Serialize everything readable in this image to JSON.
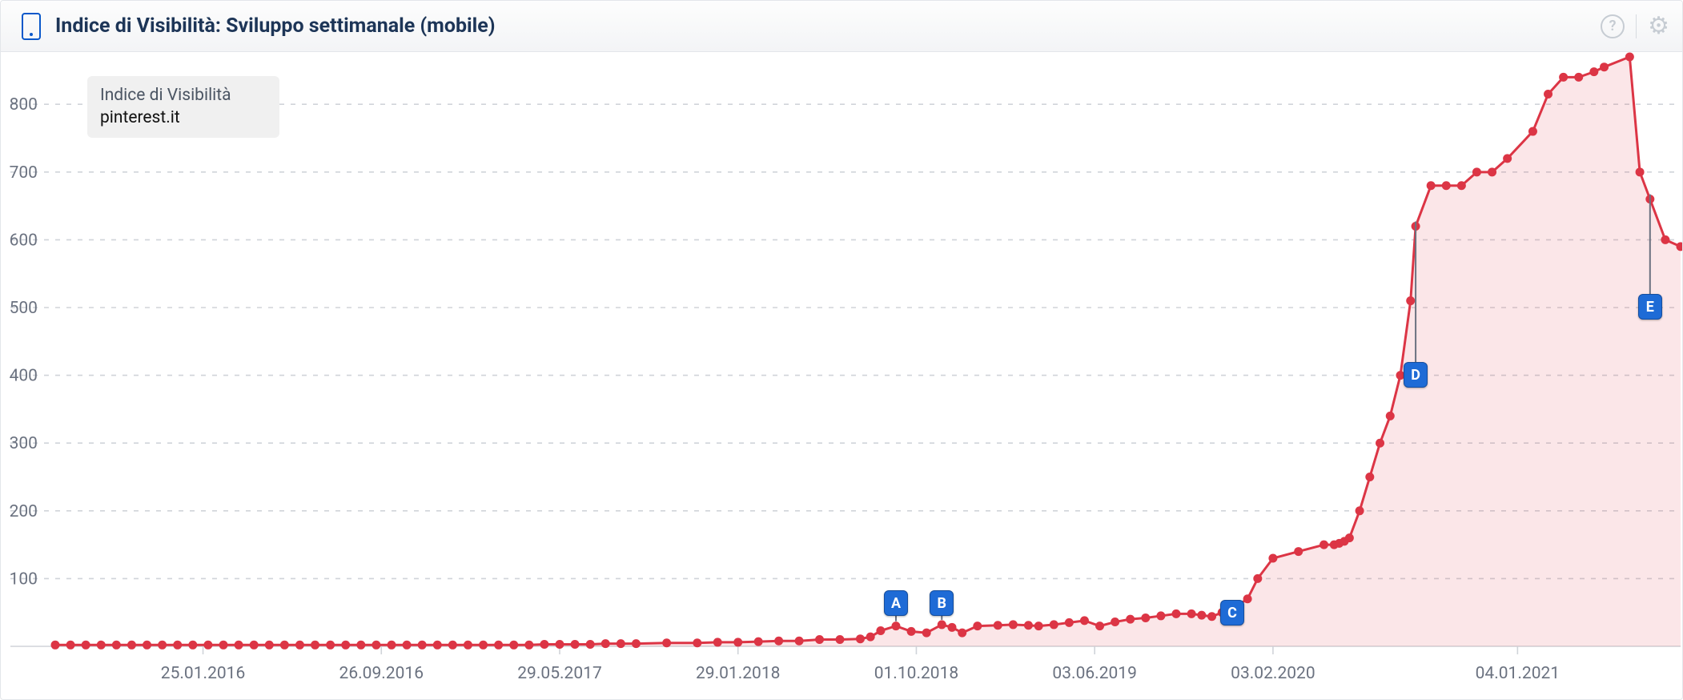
{
  "header": {
    "title": "Indice di Visibilità: Sviluppo settimanale (mobile)"
  },
  "legend": {
    "line1": "Indice di Visibilità",
    "line2": "pinterest.it"
  },
  "chart_data": {
    "type": "area",
    "title": "Indice di Visibilità: Sviluppo settimanale (mobile)",
    "xlabel": "",
    "ylabel": "",
    "ylim": [
      0,
      870
    ],
    "xlim": [
      0,
      319
    ],
    "y_ticks": [
      100,
      200,
      300,
      400,
      500,
      600,
      700,
      800
    ],
    "x_tick_labels": [
      "25.01.2016",
      "26.09.2016",
      "29.05.2017",
      "29.01.2018",
      "01.10.2018",
      "03.06.2019",
      "03.02.2020",
      "04.01.2021"
    ],
    "x_tick_positions": [
      29,
      64,
      99,
      134,
      169,
      204,
      239,
      287
    ],
    "series": [
      {
        "name": "pinterest.it",
        "color": "#dc3545",
        "x": [
          0,
          3,
          6,
          9,
          12,
          15,
          18,
          21,
          24,
          27,
          30,
          33,
          36,
          39,
          42,
          45,
          48,
          51,
          54,
          57,
          60,
          63,
          66,
          69,
          72,
          75,
          78,
          81,
          84,
          87,
          90,
          93,
          96,
          99,
          102,
          105,
          108,
          111,
          114,
          120,
          126,
          130,
          134,
          138,
          142,
          146,
          150,
          154,
          158,
          160,
          162,
          165,
          168,
          171,
          174,
          176,
          178,
          181,
          185,
          188,
          191,
          193,
          196,
          199,
          202,
          205,
          208,
          211,
          214,
          217,
          220,
          223,
          225,
          227,
          229,
          230,
          232,
          234,
          236,
          239,
          244,
          249,
          251,
          252,
          253,
          254,
          256,
          258,
          260,
          262,
          264,
          266,
          267,
          270,
          273,
          276,
          279,
          282,
          285,
          290,
          293,
          296,
          299,
          302,
          304,
          309,
          311,
          313,
          316,
          319
        ],
        "values": [
          2,
          2,
          2,
          2,
          2,
          2,
          2,
          2,
          2,
          2,
          2,
          2,
          2,
          2,
          2,
          2,
          2,
          2,
          2,
          2,
          2,
          2,
          2,
          2,
          2,
          2,
          2,
          2,
          2,
          2,
          2,
          2,
          3,
          3,
          3,
          3,
          4,
          4,
          4,
          5,
          5,
          6,
          6,
          7,
          8,
          8,
          10,
          10,
          11,
          14,
          23,
          30,
          22,
          20,
          32,
          28,
          20,
          30,
          31,
          32,
          31,
          30,
          32,
          35,
          38,
          30,
          36,
          40,
          42,
          45,
          48,
          48,
          46,
          44,
          50,
          55,
          60,
          70,
          100,
          130,
          140,
          150,
          150,
          152,
          155,
          160,
          200,
          250,
          300,
          340,
          400,
          510,
          620,
          680,
          680,
          680,
          700,
          700,
          720,
          760,
          815,
          840,
          840,
          848,
          855,
          870,
          700,
          660,
          600,
          590
        ]
      }
    ],
    "annotations": [
      {
        "label": "A",
        "x": 165,
        "line_to_value": 30
      },
      {
        "label": "B",
        "x": 174,
        "line_to_value": 32
      },
      {
        "label": "C",
        "x": 231,
        "line_to_value": 60
      },
      {
        "label": "D",
        "x": 267,
        "line_to_value": 620
      },
      {
        "label": "E",
        "x": 313,
        "line_to_value": 660
      }
    ]
  },
  "icons": {
    "help": "?",
    "gear": "⚙"
  },
  "flags": {
    "A": "A",
    "B": "B",
    "C": "C",
    "D": "D",
    "E": "E"
  }
}
